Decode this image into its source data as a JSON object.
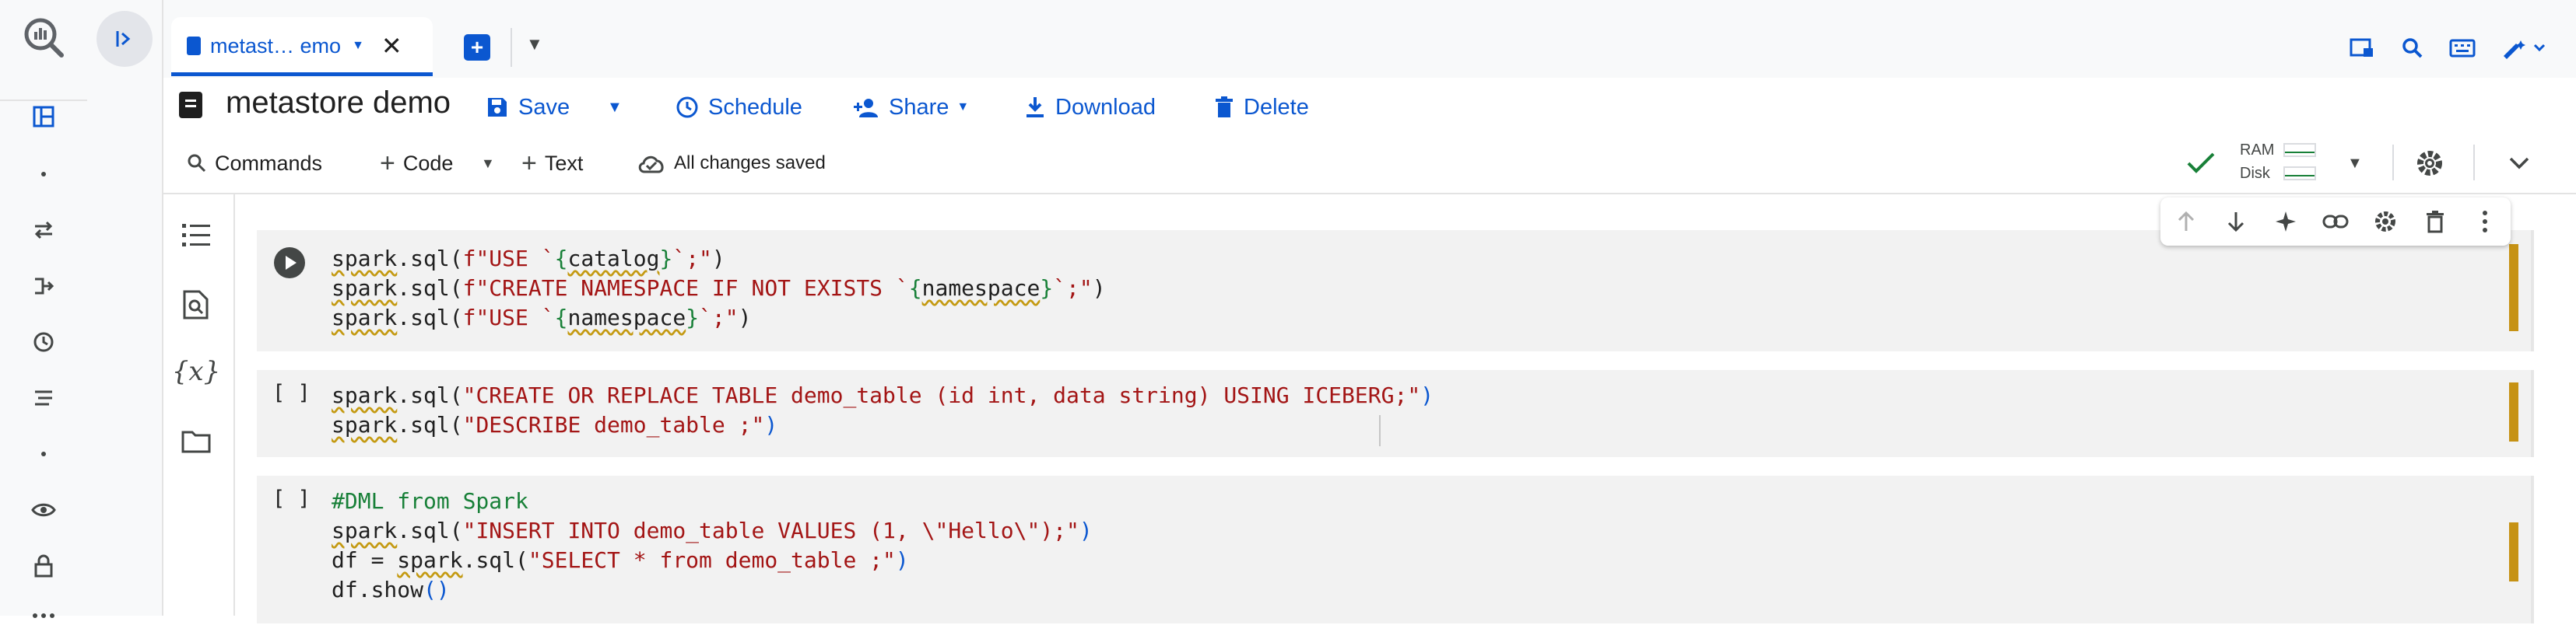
{
  "tab": {
    "title": "metast… emo"
  },
  "notebook": {
    "title": "metastore demo"
  },
  "actions": {
    "save": "Save",
    "schedule": "Schedule",
    "share": "Share",
    "download": "Download",
    "delete": "Delete"
  },
  "toolbar": {
    "commands": "Commands",
    "code": "Code",
    "text": "Text",
    "status": "All changes saved"
  },
  "resources": {
    "ram": "RAM",
    "disk": "Disk"
  },
  "side_panel": {
    "variables_label": "{x}"
  },
  "cells": [
    {
      "bracket": "",
      "lines": [
        [
          {
            "c": "t-id",
            "t": "spark"
          },
          {
            "c": "t-p",
            "t": ".sql("
          },
          {
            "c": "t-s",
            "t": "f\"USE `"
          },
          {
            "c": "t-c",
            "t": "{"
          },
          {
            "c": "t-id",
            "t": "catalog"
          },
          {
            "c": "t-c",
            "t": "}"
          },
          {
            "c": "t-s",
            "t": "`;\""
          },
          {
            "c": "t-p",
            "t": ")"
          }
        ],
        [
          {
            "c": "t-id",
            "t": "spark"
          },
          {
            "c": "t-p",
            "t": ".sql("
          },
          {
            "c": "t-s",
            "t": "f\"CREATE NAMESPACE IF NOT EXISTS `"
          },
          {
            "c": "t-c",
            "t": "{"
          },
          {
            "c": "t-id",
            "t": "namespace"
          },
          {
            "c": "t-c",
            "t": "}"
          },
          {
            "c": "t-s",
            "t": "`;\""
          },
          {
            "c": "t-p",
            "t": ")"
          }
        ],
        [
          {
            "c": "t-id",
            "t": "spark"
          },
          {
            "c": "t-p",
            "t": ".sql("
          },
          {
            "c": "t-s",
            "t": "f\"USE `"
          },
          {
            "c": "t-c",
            "t": "{"
          },
          {
            "c": "t-id",
            "t": "namespace"
          },
          {
            "c": "t-c",
            "t": "}"
          },
          {
            "c": "t-s",
            "t": "`;\""
          },
          {
            "c": "t-p",
            "t": ")"
          }
        ]
      ]
    },
    {
      "bracket": "[ ]",
      "lines": [
        [
          {
            "c": "t-id",
            "t": "spark"
          },
          {
            "c": "t-p",
            "t": ".sql("
          },
          {
            "c": "t-s",
            "t": "\"CREATE OR REPLACE TABLE demo_table (id int, data string) USING ICEBERG;\""
          },
          {
            "c": "t-b",
            "t": ")"
          }
        ],
        [
          {
            "c": "t-id",
            "t": "spark"
          },
          {
            "c": "t-p",
            "t": ".sql("
          },
          {
            "c": "t-s",
            "t": "\"DESCRIBE demo_table ;\""
          },
          {
            "c": "t-b",
            "t": ")"
          }
        ]
      ]
    },
    {
      "bracket": "[ ]",
      "lines": [
        [
          {
            "c": "t-c",
            "t": "#DML from Spark"
          }
        ],
        [
          {
            "c": "t-id",
            "t": "spark"
          },
          {
            "c": "t-p",
            "t": ".sql("
          },
          {
            "c": "t-s",
            "t": "\"INSERT INTO demo_table VALUES (1, \\\"Hello\\\");\""
          },
          {
            "c": "t-b",
            "t": ")"
          }
        ],
        [
          {
            "c": "t-v",
            "t": "df = "
          },
          {
            "c": "t-id",
            "t": "spark"
          },
          {
            "c": "t-p",
            "t": ".sql("
          },
          {
            "c": "t-s",
            "t": "\"SELECT * from demo_table ;\""
          },
          {
            "c": "t-b",
            "t": ")"
          }
        ],
        [
          {
            "c": "t-v",
            "t": "df.show"
          },
          {
            "c": "t-b",
            "t": "()"
          }
        ]
      ]
    }
  ]
}
